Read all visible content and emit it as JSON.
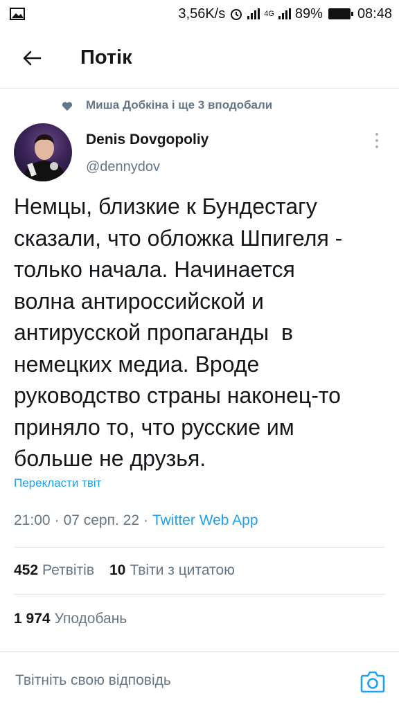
{
  "status_bar": {
    "net_speed": "3,56K/s",
    "signal_label": "4G",
    "battery": "89%",
    "time": "08:48"
  },
  "header": {
    "title": "Потік"
  },
  "tweet": {
    "social_context": "Миша Добкіна і ще 3 вподобали",
    "author_name": "Denis Dovgopoliy",
    "author_handle": "@dennydov",
    "text": "Немцы, близкие к Бундестагу\nсказали, что обложка Шпигеля -\nтолько начала. Начинается\nволна антироссийской и\nантирусской пропаганды  в\nнемецких медиа. Вроде\nруководство страны наконец-то\nприняло то, что русские им\nбольше не друзья.",
    "translate_label": "Перекласти твіт",
    "time": "21:00",
    "date": "07 серп. 22",
    "dot": "·",
    "source_app": "Twitter Web App",
    "retweets_count": "452",
    "retweets_label": "Ретвітів",
    "quotes_count": "10",
    "quotes_label": "Твіти з цитатою",
    "likes_count": "1 974",
    "likes_label": "Уподобань"
  },
  "reply_bar": {
    "placeholder": "Твітніть свою відповідь"
  },
  "colors": {
    "accent": "#1da1f2",
    "secondary_text": "#657786",
    "primary_text": "#14171a",
    "divider": "#e1e8ed"
  },
  "icons": {
    "back": "arrow-left-icon",
    "like_context": "heart-icon",
    "more": "more-vertical-icon",
    "camera": "camera-icon",
    "gallery": "image-icon",
    "alarm": "alarm-clock-icon"
  }
}
